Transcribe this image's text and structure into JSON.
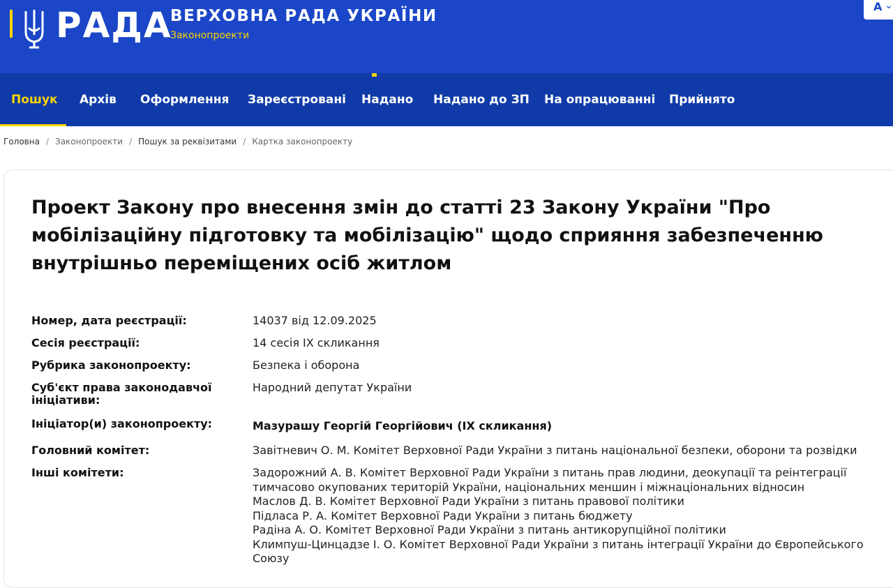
{
  "header": {
    "logo": "РАДА",
    "title": "ВЕРХОВНА РАДА УКРАЇНИ",
    "subtitle": "Законопроекти",
    "lang_label": "A",
    "lang_icon": "chevron-down-icon",
    "colors": {
      "primary": "#1b46c7",
      "nav": "#0f3aa8",
      "accent": "#ffd400"
    }
  },
  "nav": {
    "items": [
      "Пошук",
      "Архів",
      "Оформлення",
      "Зареєстровані",
      "Надано",
      "Надано до ЗП",
      "На опрацюванні",
      "Прийнято"
    ],
    "active": "Пошук"
  },
  "breadcrumb": {
    "items": [
      "Головна",
      "Законопроекти",
      "Пошук за реквізитами"
    ],
    "current": "Картка законопроекту",
    "separator": "/"
  },
  "bill": {
    "title": "Проект Закону про внесення змін до статті 23 Закону України \"Про мобілізаційну підготовку та мобілізацію\" щодо сприяння забезпеченню внутрішньо переміщених осіб житлом",
    "fields": [
      {
        "label": "Номер, дата реєстрації:",
        "value": "14037 від 12.09.2025"
      },
      {
        "label": "Сесія реєстрації:",
        "value": "14 сесія IX скликання"
      },
      {
        "label": "Рубрика законопроекту:",
        "value": "Безпека і оборона"
      },
      {
        "label": "Суб'єкт права законодавчої ініціативи:",
        "value": "Народний депутат України"
      },
      {
        "label": "Ініціатор(и) законопроекту:",
        "value": "Мазурашу Георгій Георгійович (IX скликання)"
      },
      {
        "label": "Головний комітет:",
        "value": "Завітневич О. М. Комітет Верховної Ради України з питань національної безпеки, оборони та розвідки"
      }
    ],
    "other_committees_label": "Інші комітети:",
    "other_committees": [
      "Задорожний А. В. Комітет Верховної Ради України з питань прав людини, деокупації та реінтеграції",
      "тимчасово окупованих територій України, національних меншин і міжнаціональних відносин",
      "Маслов Д. В. Комітет Верховної Ради України з питань правової політики",
      "Підласа Р. А. Комітет Верховної Ради України з питань бюджету",
      "Радіна А. О. Комітет Верховної Ради України з питань антикорупційної політики",
      "Климпуш-Цинцадзе І. О. Комітет Верховної Ради України з питань інтеграції України до Європейського",
      "Союзу"
    ]
  }
}
